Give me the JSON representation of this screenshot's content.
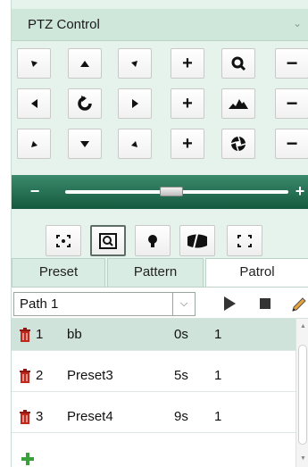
{
  "panel": {
    "title": "PTZ Control",
    "collapse_icon": "chevron-down-icon"
  },
  "ptz_buttons": [
    {
      "name": "move-up-left-button",
      "icon": "arrow-up-left-icon",
      "glyph": ""
    },
    {
      "name": "move-up-button",
      "icon": "arrow-up-icon",
      "glyph": ""
    },
    {
      "name": "move-up-right-button",
      "icon": "arrow-up-right-icon",
      "glyph": ""
    },
    {
      "name": "zoom-in-button",
      "icon": "plus-icon",
      "glyph": "+"
    },
    {
      "name": "zoom-label",
      "icon": "zoom-icon",
      "glyph": ""
    },
    {
      "name": "zoom-out-button",
      "icon": "minus-icon",
      "glyph": "−"
    },
    {
      "name": "move-left-button",
      "icon": "arrow-left-icon",
      "glyph": ""
    },
    {
      "name": "auto-pan-button",
      "icon": "rotate-icon",
      "glyph": ""
    },
    {
      "name": "move-right-button",
      "icon": "arrow-right-icon",
      "glyph": ""
    },
    {
      "name": "focus-near-button",
      "icon": "plus-icon",
      "glyph": "+"
    },
    {
      "name": "focus-label",
      "icon": "focus-icon",
      "glyph": ""
    },
    {
      "name": "focus-far-button",
      "icon": "minus-icon",
      "glyph": "−"
    },
    {
      "name": "move-down-left-button",
      "icon": "arrow-down-left-icon",
      "glyph": ""
    },
    {
      "name": "move-down-button",
      "icon": "arrow-down-icon",
      "glyph": ""
    },
    {
      "name": "move-down-right-button",
      "icon": "arrow-down-right-icon",
      "glyph": ""
    },
    {
      "name": "iris-open-button",
      "icon": "plus-icon",
      "glyph": "+"
    },
    {
      "name": "iris-label",
      "icon": "iris-icon",
      "glyph": ""
    },
    {
      "name": "iris-close-button",
      "icon": "minus-icon",
      "glyph": "−"
    }
  ],
  "speed_slider": {
    "minus": "−",
    "plus": "+",
    "value_fraction": 0.5
  },
  "aux_buttons": [
    {
      "name": "3d-positioning-button",
      "icon": "3d-position-icon"
    },
    {
      "name": "regional-focus-button",
      "icon": "regional-focus-icon",
      "active": true
    },
    {
      "name": "light-button",
      "icon": "light-bulb-icon"
    },
    {
      "name": "wiper-button",
      "icon": "wiper-icon"
    },
    {
      "name": "regional-exposure-button",
      "icon": "regional-exposure-icon"
    }
  ],
  "tabs": [
    {
      "label": "Preset",
      "active": false
    },
    {
      "label": "Pattern",
      "active": false
    },
    {
      "label": "Patrol",
      "active": true
    }
  ],
  "patrol": {
    "path_selected": "Path 1",
    "play_icon": "play-icon",
    "stop_icon": "stop-icon",
    "edit_icon": "pencil-icon",
    "rows": [
      {
        "num": "1",
        "preset": "bb",
        "time": "0s",
        "speed": "1",
        "selected": true
      },
      {
        "num": "2",
        "preset": "Preset3",
        "time": "5s",
        "speed": "1",
        "selected": false
      },
      {
        "num": "3",
        "preset": "Preset4",
        "time": "9s",
        "speed": "1",
        "selected": false
      }
    ],
    "add_icon": "add-plus-icon",
    "delete_icon": "trash-icon"
  },
  "colors": {
    "panel_bg": "#e6f2ec",
    "title_bg": "#cfe7db",
    "slider_bar": "#1f6b4e",
    "row_selected": "#cfe3da",
    "delete_red": "#c0281c",
    "add_green": "#3aa13a"
  }
}
